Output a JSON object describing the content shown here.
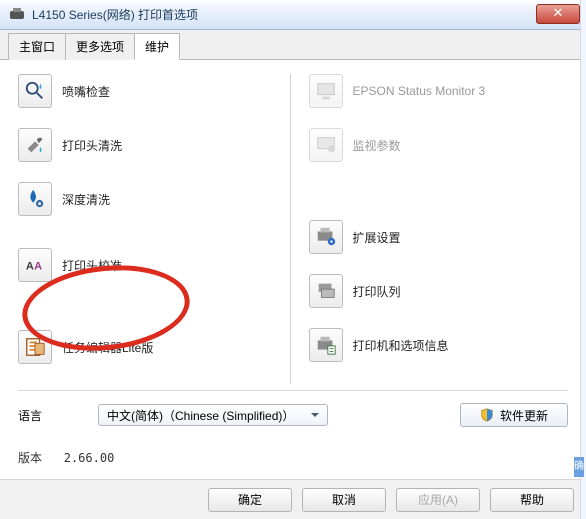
{
  "window": {
    "title": "L4150 Series(网络) 打印首选项"
  },
  "tabs": {
    "items": [
      {
        "label": "主窗口",
        "active": false
      },
      {
        "label": "更多选项",
        "active": false
      },
      {
        "label": "维护",
        "active": true
      }
    ]
  },
  "maintenance": {
    "left": [
      {
        "key": "nozzle-check",
        "label": "喷嘴检查",
        "icon": "magnifier-drop"
      },
      {
        "key": "head-clean",
        "label": "打印头清洗",
        "icon": "wrench-drop"
      },
      {
        "key": "deep-clean",
        "label": "深度清洗",
        "icon": "drop-gear"
      },
      {
        "key": "head-align",
        "label": "打印头校准",
        "icon": "aa-align",
        "highlighted": true
      },
      {
        "key": "task-editor",
        "label": "任务编辑器Lite版",
        "icon": "task-list"
      }
    ],
    "right": [
      {
        "key": "status-monitor",
        "label": "EPSON Status Monitor 3",
        "icon": "monitor",
        "disabled": true
      },
      {
        "key": "monitor-params",
        "label": "监视参数",
        "icon": "params",
        "disabled": true
      },
      {
        "key": "ext-settings",
        "label": "扩展设置",
        "icon": "printer-gear"
      },
      {
        "key": "print-queue",
        "label": "打印队列",
        "icon": "queue"
      },
      {
        "key": "printer-info",
        "label": "打印机和选项信息",
        "icon": "printer-info"
      }
    ]
  },
  "language": {
    "label": "语言",
    "selected": "中文(简体)（Chinese (Simplified)）"
  },
  "update_button": "软件更新",
  "version": {
    "label": "版本",
    "value": "2.66.00"
  },
  "footer": {
    "ok": "确定",
    "cancel": "取消",
    "apply": "应用(A)",
    "help": "帮助"
  },
  "partial": "确"
}
